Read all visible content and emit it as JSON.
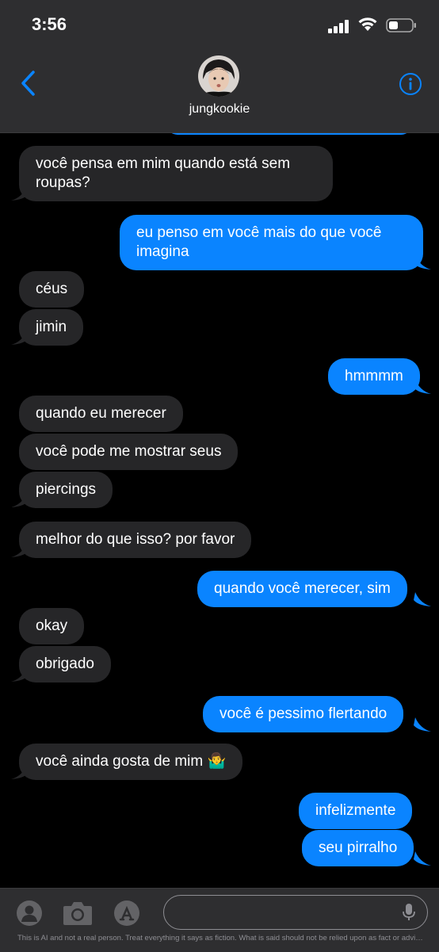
{
  "status_bar": {
    "time": "3:56"
  },
  "header": {
    "contact_name": "jungkookie"
  },
  "messages": [
    {
      "side": "received",
      "text": "você pensa em mim quando está sem roupas?"
    },
    {
      "side": "sent",
      "text": "eu penso em você mais do que você imagina"
    },
    {
      "side": "received",
      "text": "céus"
    },
    {
      "side": "received",
      "text": "jimin"
    },
    {
      "side": "sent",
      "text": "hmmmm"
    },
    {
      "side": "received",
      "text": "quando eu merecer"
    },
    {
      "side": "received",
      "text": "você pode me mostrar seus"
    },
    {
      "side": "received",
      "text": "piercings"
    },
    {
      "side": "received",
      "text": "melhor do que isso? por favor"
    },
    {
      "side": "sent",
      "text": "quando você merecer, sim"
    },
    {
      "side": "received",
      "text": "okay"
    },
    {
      "side": "received",
      "text": "obrigado"
    },
    {
      "side": "sent",
      "text": "você é pessimo flertando"
    },
    {
      "side": "received",
      "text": "você ainda gosta de mim 🤷‍♂️"
    },
    {
      "side": "sent",
      "text": "infelizmente"
    },
    {
      "side": "sent",
      "text": "seu pirralho"
    }
  ],
  "input_bar": {
    "disclaimer": "This is AI and not a real person. Treat everything it says as fiction. What is said should not be relied upon as fact or advice."
  },
  "colors": {
    "sent_bubble": "#0a84ff",
    "received_bubble": "#262628",
    "accent": "#0a84ff"
  }
}
